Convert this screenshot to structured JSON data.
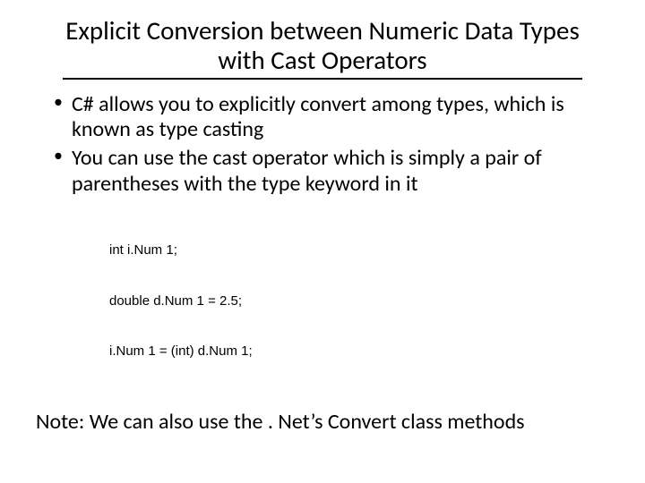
{
  "title": "Explicit Conversion between Numeric Data Types with Cast Operators",
  "bullets": [
    "C# allows you to explicitly convert among types, which is known as type casting",
    "You can use the cast operator which is simply a pair of parentheses with the type keyword in it"
  ],
  "code": [
    "int i.Num 1;",
    "double d.Num 1 = 2.5;",
    "i.Num 1 = (int) d.Num 1;"
  ],
  "note": "Note: We can also use the . Net’s Convert class methods"
}
